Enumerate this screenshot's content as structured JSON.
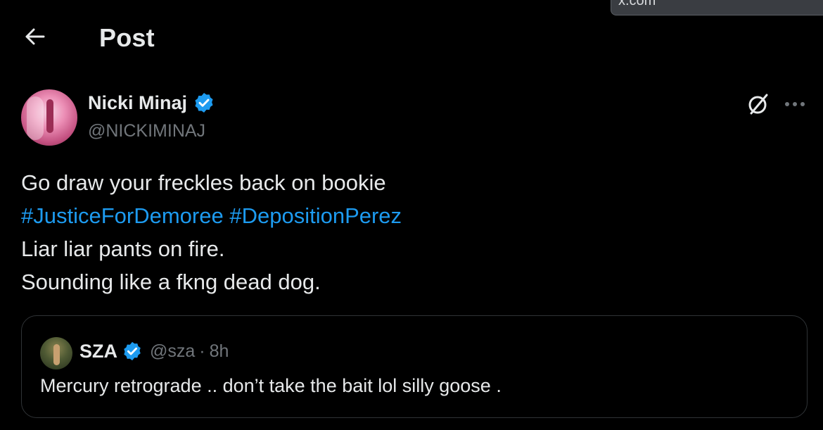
{
  "browser": {
    "url_text": "x.com"
  },
  "header": {
    "title": "Post",
    "back_icon": "arrow-left-icon"
  },
  "post": {
    "author": {
      "display_name": "Nicki Minaj",
      "handle": "@NICKIMINAJ",
      "verified": true
    },
    "lines": {
      "line1": "Go draw your freckles back on bookie",
      "hashtag1": "#JusticeForDemoree",
      "hashtag2": "#DepositionPerez",
      "line3": "Liar liar pants on fire.",
      "line4": "Sounding like a fkng dead dog."
    },
    "actions": {
      "grok_icon": "grok-icon",
      "more_icon": "more-dots-icon"
    }
  },
  "quote": {
    "author": {
      "display_name": "SZA",
      "handle": "@sza",
      "separator": "·",
      "time": "8h",
      "verified": true
    },
    "text": "Mercury retrograde .. don’t take the bait lol silly goose ."
  },
  "colors": {
    "background": "#000000",
    "text_primary": "#e7e9ea",
    "text_secondary": "#71767b",
    "accent": "#1d9bf0",
    "border": "#2f3336"
  }
}
